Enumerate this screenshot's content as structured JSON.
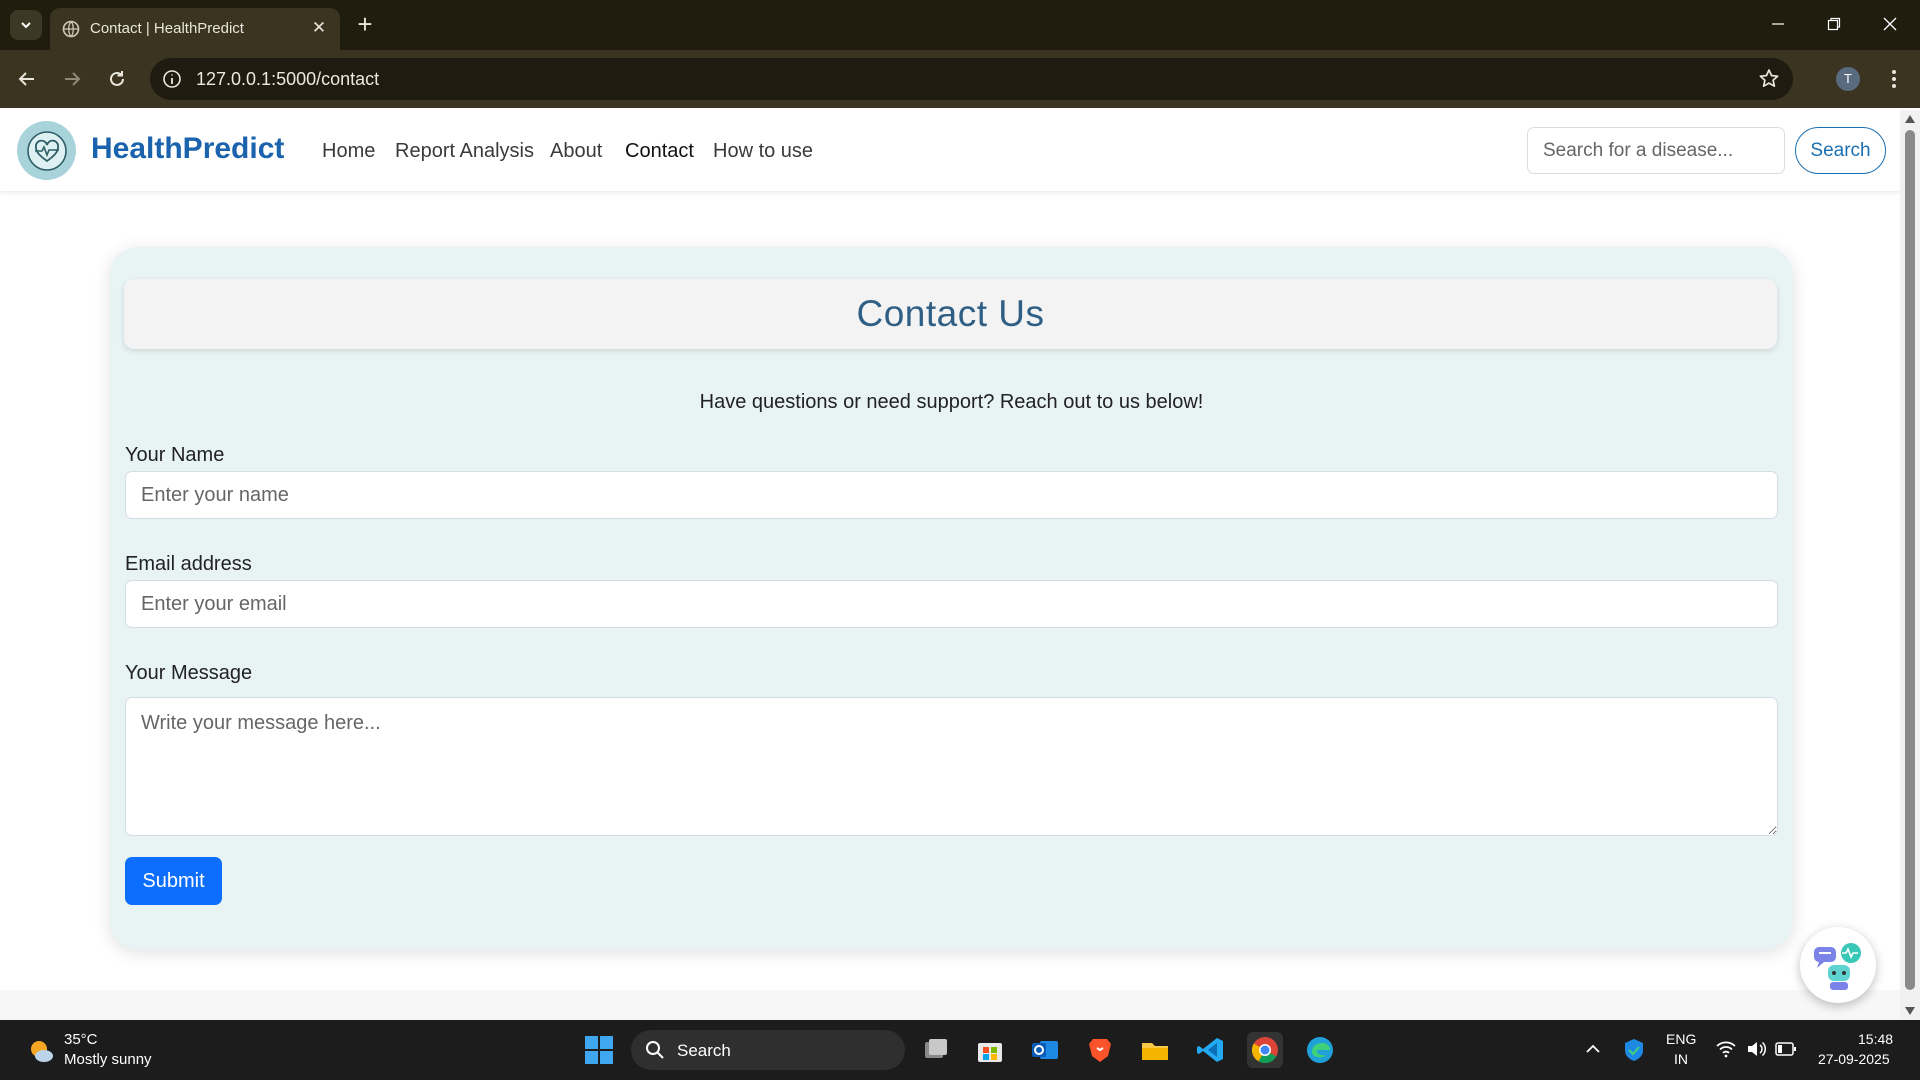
{
  "browser": {
    "tab_title": "Contact | HealthPredict",
    "url": "127.0.0.1:5000/contact",
    "profile_initial": "T"
  },
  "navbar": {
    "brand": "HealthPredict",
    "links": [
      "Home",
      "Report Analysis",
      "About",
      "Contact",
      "How to use"
    ],
    "active_link": "Contact",
    "search_placeholder": "Search for a disease...",
    "search_button": "Search"
  },
  "contact": {
    "title": "Contact Us",
    "subtitle": "Have questions or need support? Reach out to us below!",
    "name_label": "Your Name",
    "name_placeholder": "Enter your name",
    "email_label": "Email address",
    "email_placeholder": "Enter your email",
    "message_label": "Your Message",
    "message_placeholder": "Write your message here...",
    "submit_label": "Submit"
  },
  "taskbar": {
    "weather_temp": "35°C",
    "weather_desc": "Mostly sunny",
    "search_label": "Search",
    "lang_top": "ENG",
    "lang_bottom": "IN",
    "time": "15:48",
    "date": "27-09-2025"
  },
  "colors": {
    "brand": "#1b63ad",
    "card_bg": "#e8f4f4",
    "submit": "#0d6efd",
    "title": "#2f5f85"
  }
}
